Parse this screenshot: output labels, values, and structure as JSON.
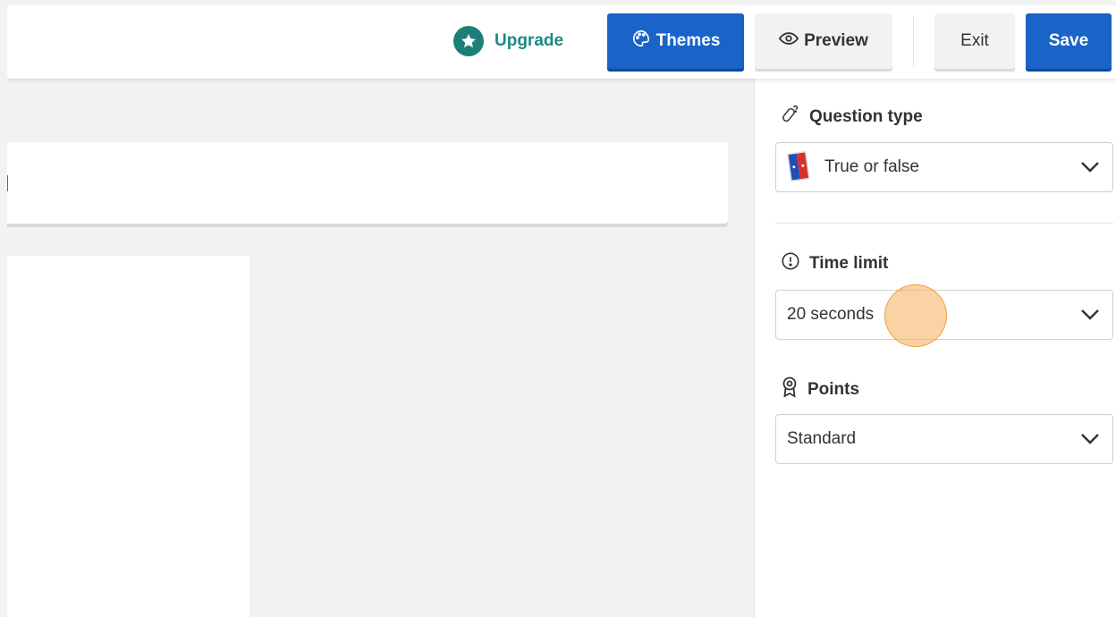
{
  "topbar": {
    "upgrade_label": "Upgrade",
    "themes_label": "Themes",
    "preview_label": "Preview",
    "exit_label": "Exit",
    "save_label": "Save"
  },
  "sidebar": {
    "question_type": {
      "label": "Question type",
      "value": "True or false",
      "icon": "question-type-icon"
    },
    "time_limit": {
      "label": "Time limit",
      "value": "20 seconds",
      "icon": "clock-icon"
    },
    "points": {
      "label": "Points",
      "value": "Standard",
      "icon": "medal-icon"
    }
  },
  "colors": {
    "primary": "#1a63c8",
    "upgrade": "#1d8a82",
    "cursor_highlight": "#f5af5a"
  }
}
